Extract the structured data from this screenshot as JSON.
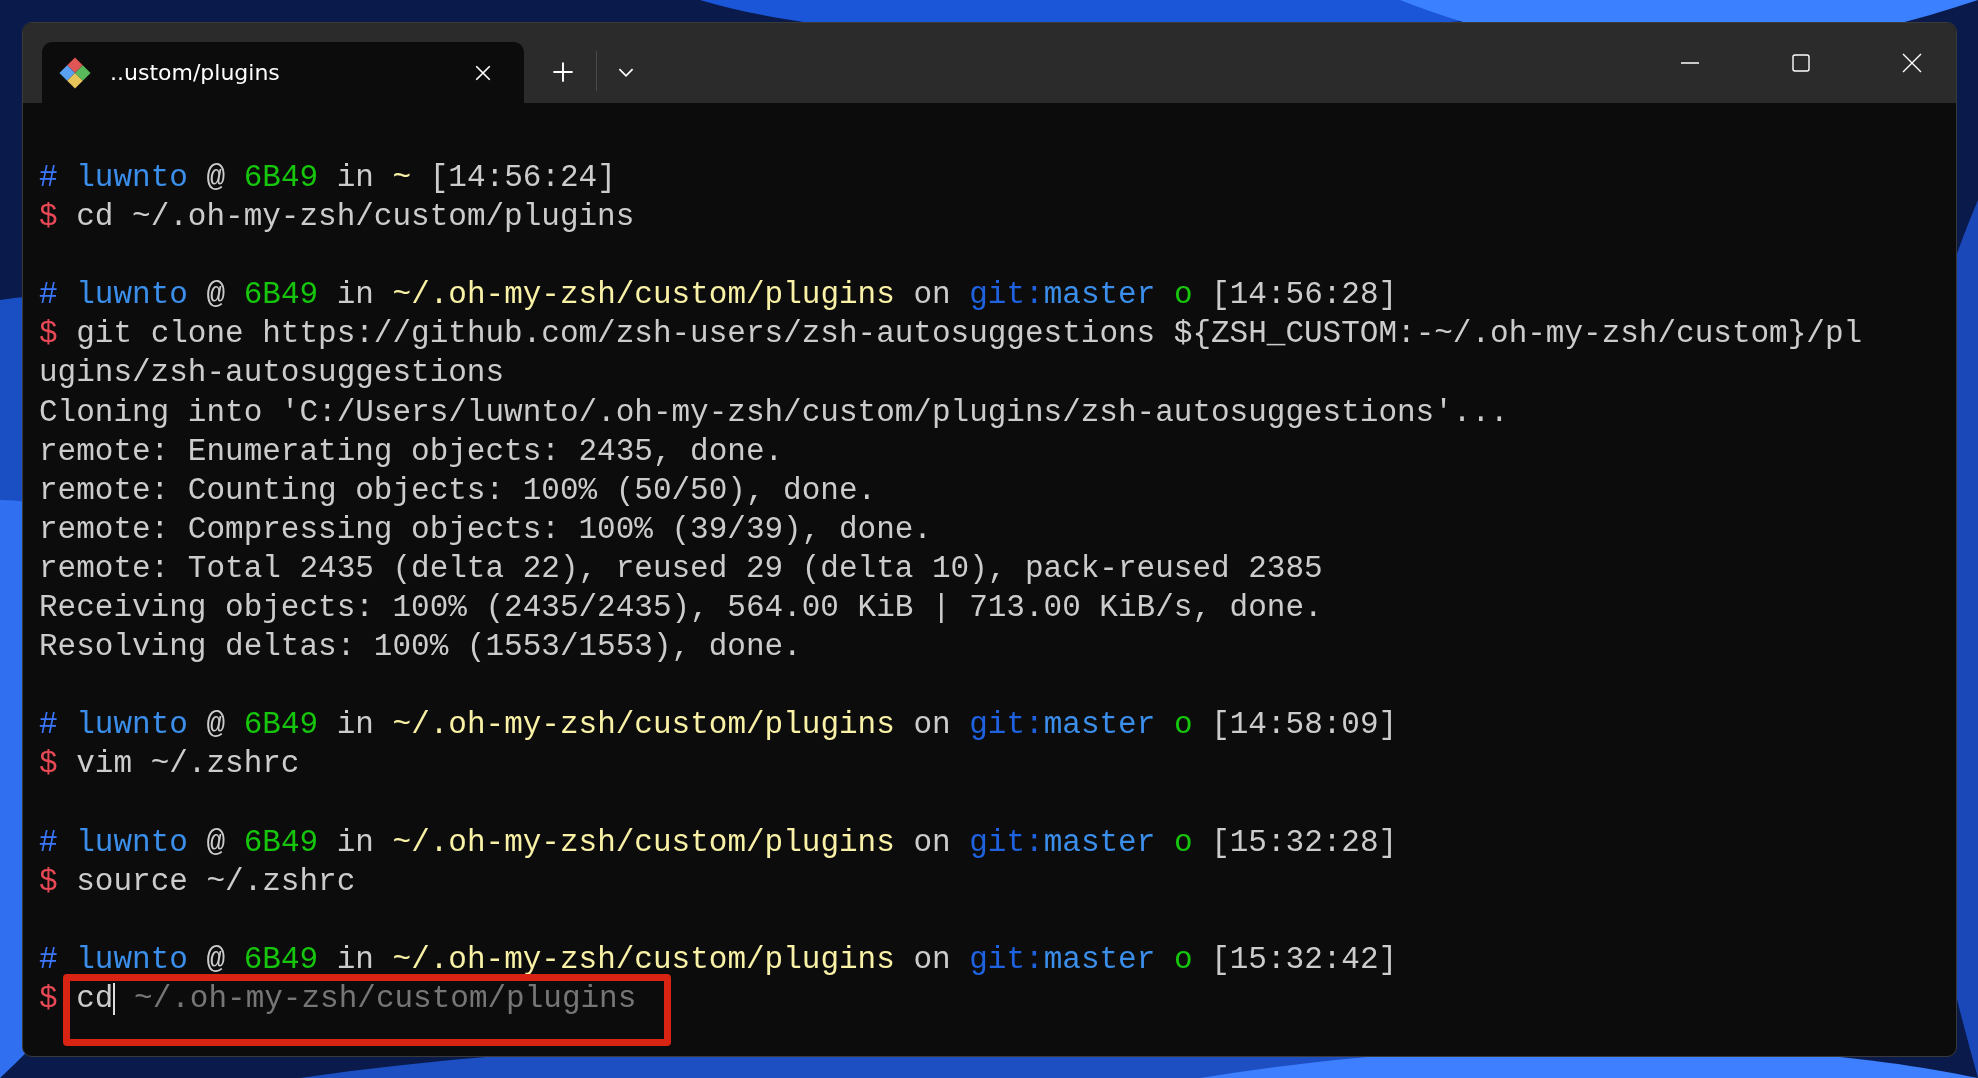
{
  "window": {
    "tab": {
      "title": "..ustom/plugins",
      "selected": true
    }
  },
  "terminal": {
    "lines": [
      {
        "kind": "prompt",
        "segments": [
          {
            "kind": "hash",
            "text": "#"
          },
          {
            "kind": "user",
            "text": "luwnto"
          },
          {
            "kind": "plain",
            "text": "@"
          },
          {
            "kind": "host",
            "text": "6B49"
          },
          {
            "kind": "plain",
            "text": "in"
          },
          {
            "kind": "path",
            "text": "~"
          },
          {
            "kind": "time",
            "text": "[14:56:24]"
          }
        ]
      },
      {
        "kind": "command",
        "segments": [
          {
            "kind": "dollar",
            "text": "$"
          },
          {
            "kind": "cmd",
            "text": "cd ~/.oh-my-zsh/custom/plugins"
          }
        ]
      },
      {
        "kind": "blank"
      },
      {
        "kind": "prompt",
        "segments": [
          {
            "kind": "hash",
            "text": "#"
          },
          {
            "kind": "user",
            "text": "luwnto"
          },
          {
            "kind": "plain",
            "text": "@"
          },
          {
            "kind": "host",
            "text": "6B49"
          },
          {
            "kind": "plain",
            "text": "in"
          },
          {
            "kind": "path",
            "text": "~/.oh-my-zsh/custom/plugins"
          },
          {
            "kind": "plain",
            "text": "on"
          },
          {
            "kind": "git",
            "text": "git:"
          },
          {
            "kind": "branch",
            "text": "master"
          },
          {
            "kind": "mark",
            "text": "o"
          },
          {
            "kind": "time",
            "text": "[14:56:28]"
          }
        ]
      },
      {
        "kind": "command",
        "segments": [
          {
            "kind": "dollar",
            "text": "$"
          },
          {
            "kind": "cmd",
            "text": "git clone https://github.com/zsh-users/zsh-autosuggestions ${ZSH_CUSTOM:-~/.oh-my-zsh/custom}/pl"
          }
        ]
      },
      {
        "kind": "output",
        "text": "ugins/zsh-autosuggestions"
      },
      {
        "kind": "output",
        "text": "Cloning into 'C:/Users/luwnto/.oh-my-zsh/custom/plugins/zsh-autosuggestions'..."
      },
      {
        "kind": "output",
        "text": "remote: Enumerating objects: 2435, done."
      },
      {
        "kind": "output",
        "text": "remote: Counting objects: 100% (50/50), done."
      },
      {
        "kind": "output",
        "text": "remote: Compressing objects: 100% (39/39), done."
      },
      {
        "kind": "output",
        "text": "remote: Total 2435 (delta 22), reused 29 (delta 10), pack-reused 2385"
      },
      {
        "kind": "output",
        "text": "Receiving objects: 100% (2435/2435), 564.00 KiB | 713.00 KiB/s, done."
      },
      {
        "kind": "output",
        "text": "Resolving deltas: 100% (1553/1553), done."
      },
      {
        "kind": "blank"
      },
      {
        "kind": "prompt",
        "segments": [
          {
            "kind": "hash",
            "text": "#"
          },
          {
            "kind": "user",
            "text": "luwnto"
          },
          {
            "kind": "plain",
            "text": "@"
          },
          {
            "kind": "host",
            "text": "6B49"
          },
          {
            "kind": "plain",
            "text": "in"
          },
          {
            "kind": "path",
            "text": "~/.oh-my-zsh/custom/plugins"
          },
          {
            "kind": "plain",
            "text": "on"
          },
          {
            "kind": "git",
            "text": "git:"
          },
          {
            "kind": "branch",
            "text": "master"
          },
          {
            "kind": "mark",
            "text": "o"
          },
          {
            "kind": "time",
            "text": "[14:58:09]"
          }
        ]
      },
      {
        "kind": "command",
        "segments": [
          {
            "kind": "dollar",
            "text": "$"
          },
          {
            "kind": "cmd",
            "text": "vim ~/.zshrc"
          }
        ]
      },
      {
        "kind": "blank"
      },
      {
        "kind": "prompt",
        "segments": [
          {
            "kind": "hash",
            "text": "#"
          },
          {
            "kind": "user",
            "text": "luwnto"
          },
          {
            "kind": "plain",
            "text": "@"
          },
          {
            "kind": "host",
            "text": "6B49"
          },
          {
            "kind": "plain",
            "text": "in"
          },
          {
            "kind": "path",
            "text": "~/.oh-my-zsh/custom/plugins"
          },
          {
            "kind": "plain",
            "text": "on"
          },
          {
            "kind": "git",
            "text": "git:"
          },
          {
            "kind": "branch",
            "text": "master"
          },
          {
            "kind": "mark",
            "text": "o"
          },
          {
            "kind": "time",
            "text": "[15:32:28]"
          }
        ]
      },
      {
        "kind": "command",
        "segments": [
          {
            "kind": "dollar",
            "text": "$"
          },
          {
            "kind": "cmd",
            "text": "source ~/.zshrc"
          }
        ]
      },
      {
        "kind": "blank"
      },
      {
        "kind": "prompt",
        "segments": [
          {
            "kind": "hash",
            "text": "#"
          },
          {
            "kind": "user",
            "text": "luwnto"
          },
          {
            "kind": "plain",
            "text": "@"
          },
          {
            "kind": "host",
            "text": "6B49"
          },
          {
            "kind": "plain",
            "text": "in"
          },
          {
            "kind": "path",
            "text": "~/.oh-my-zsh/custom/plugins"
          },
          {
            "kind": "plain",
            "text": "on"
          },
          {
            "kind": "git",
            "text": "git:"
          },
          {
            "kind": "branch",
            "text": "master"
          },
          {
            "kind": "mark",
            "text": "o"
          },
          {
            "kind": "time",
            "text": "[15:32:42]"
          }
        ]
      },
      {
        "kind": "command",
        "segments": [
          {
            "kind": "dollar",
            "text": "$"
          },
          {
            "kind": "cmd",
            "text": "cd"
          },
          {
            "kind": "cursor"
          },
          {
            "kind": "suggestion",
            "text": "~/.oh-my-zsh/custom/plugins"
          }
        ]
      }
    ],
    "highlight": {
      "kind": "last-line"
    }
  }
}
